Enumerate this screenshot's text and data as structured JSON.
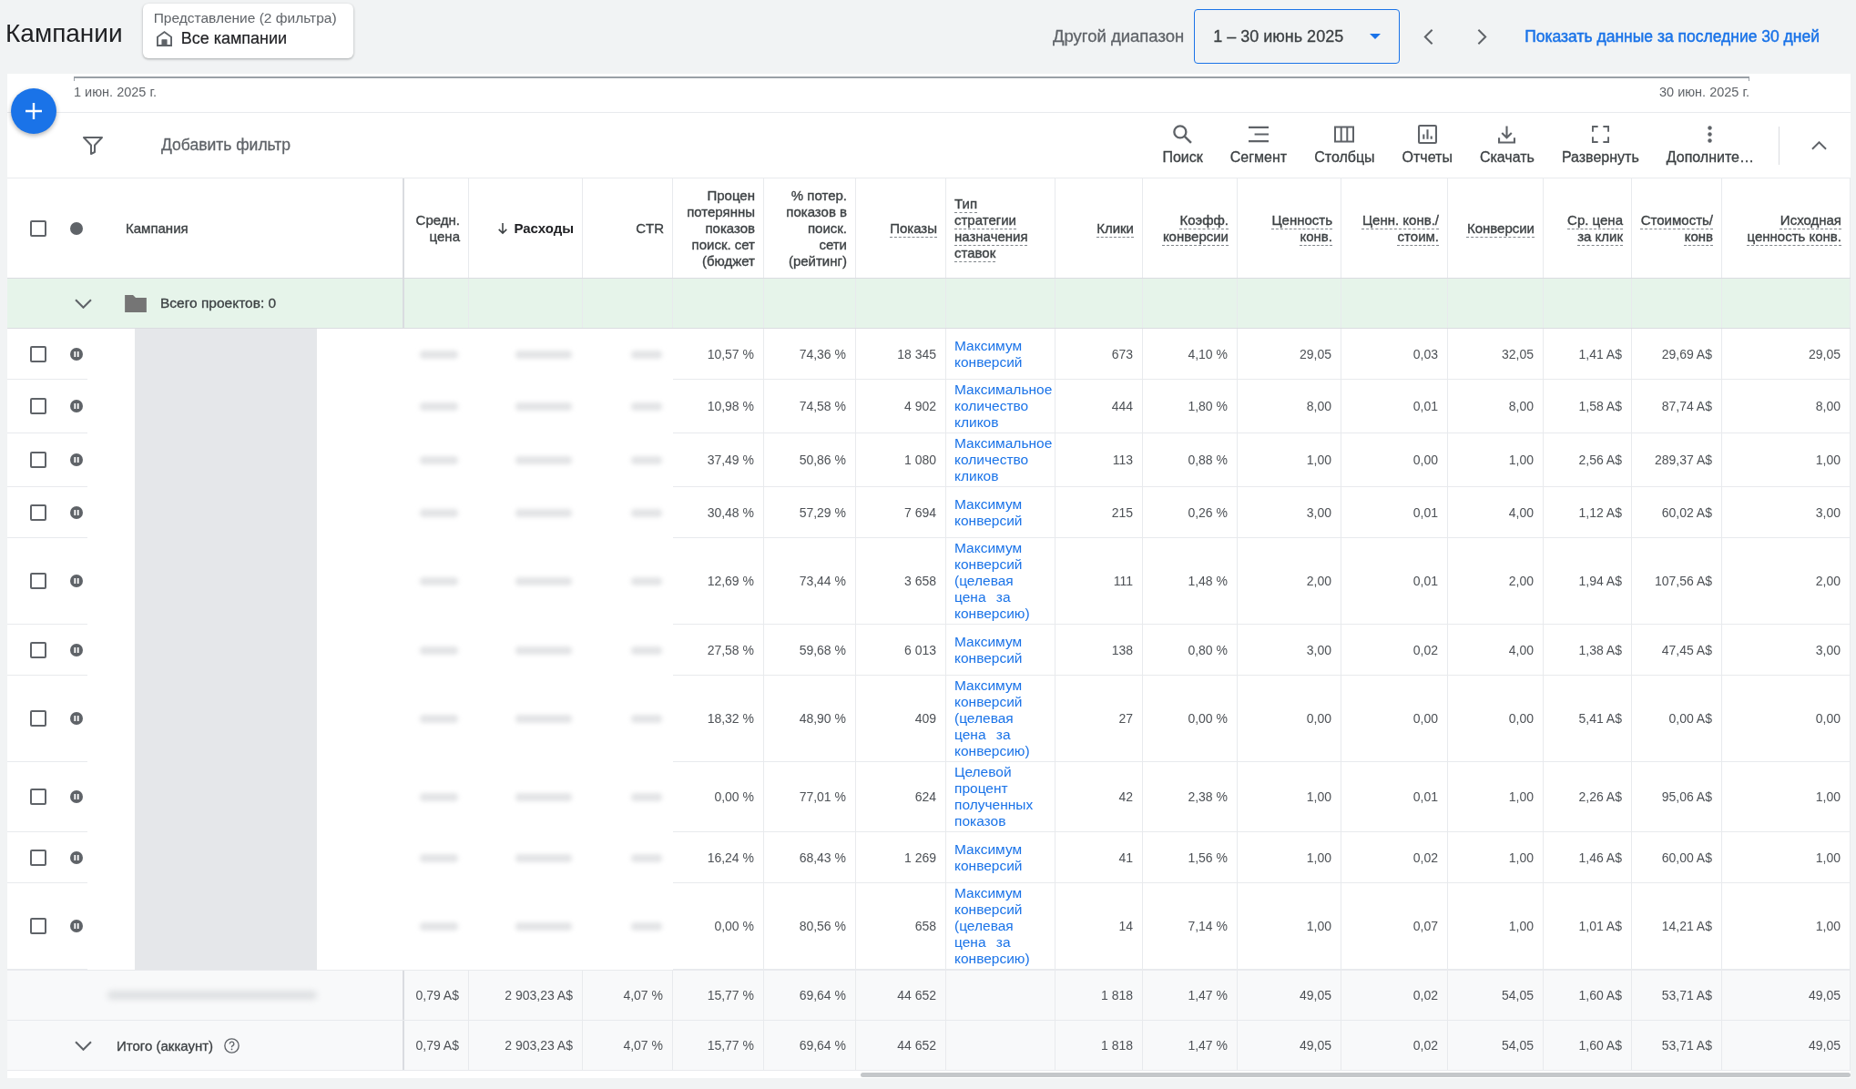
{
  "page_title": "Кампании",
  "view_selector": {
    "caption": "Представление (2 фильтра)",
    "value": "Все кампании"
  },
  "date_range": {
    "label": "Другой диапазон",
    "value": "1 – 30 июнь 2025",
    "quick_link": "Показать данные за последние 30 дней"
  },
  "timeline": {
    "start": "1 июн. 2025 г.",
    "end": "30 июн. 2025 г."
  },
  "filter_bar": {
    "add_filter": "Добавить фильтр"
  },
  "toolbar": [
    {
      "kind": "search",
      "label": "Поиск"
    },
    {
      "kind": "segment",
      "label": "Сегмент"
    },
    {
      "kind": "columns",
      "label": "Столбцы"
    },
    {
      "kind": "reports",
      "label": "Отчеты"
    },
    {
      "kind": "download",
      "label": "Скачать"
    },
    {
      "kind": "expand",
      "label": "Развернуть"
    },
    {
      "kind": "more",
      "label": "Дополните…"
    }
  ],
  "table": {
    "select_all_checked": false,
    "columns": [
      {
        "kind": "name",
        "label": "Кампания",
        "help": false,
        "sorted": false
      },
      {
        "kind": "number",
        "label": "Средн.\nцена",
        "help": false,
        "sorted": false
      },
      {
        "kind": "number",
        "label": "Расходы",
        "help": false,
        "sorted": true
      },
      {
        "kind": "number",
        "label": "CTR",
        "help": false,
        "sorted": false
      },
      {
        "kind": "number",
        "label": "Процен\nпотерянны\nпоказов\nпоиск. сет\n(бюджет",
        "help": false,
        "sorted": false
      },
      {
        "kind": "number",
        "label": "% потер.\nпоказов в\nпоиск.\nсети\n(рейтинг)",
        "help": false,
        "sorted": false
      },
      {
        "kind": "number",
        "label": "Показы",
        "help": true,
        "sorted": false
      },
      {
        "kind": "link",
        "label": "Тип\nстратегии\nназначения\nставок",
        "help": true,
        "sorted": false
      },
      {
        "kind": "number",
        "label": "Клики",
        "help": true,
        "sorted": false
      },
      {
        "kind": "number",
        "label": "Коэфф.\nконверсии",
        "help": true,
        "sorted": false
      },
      {
        "kind": "number",
        "label": "Ценность\nконв.",
        "help": true,
        "sorted": false
      },
      {
        "kind": "number",
        "label": "Ценн. конв./\nстоим.",
        "help": true,
        "sorted": false
      },
      {
        "kind": "number",
        "label": "Конверсии",
        "help": true,
        "sorted": false
      },
      {
        "kind": "number",
        "label": "Ср. цена\nза клик",
        "help": true,
        "sorted": false
      },
      {
        "kind": "number",
        "label": "Стоимость/\nконв",
        "help": true,
        "sorted": false
      },
      {
        "kind": "number",
        "label": "Исходная\nценность конв.",
        "help": true,
        "sorted": false
      }
    ],
    "group_row": {
      "label": "Всего проектов: 0"
    },
    "rows": [
      {
        "checked": false,
        "paused": true,
        "lost_is_budget": "10,57 %",
        "lost_is_rank": "74,36 %",
        "impressions": "18 345",
        "bid_strategy": "Максимум конверсий",
        "clicks": "673",
        "conv_rate": "4,10 %",
        "conv_value": "29,05",
        "value_per_cost": "0,03",
        "conversions": "32,05",
        "avg_cpc": "1,41 A$",
        "cost_per_conv": "29,69 A$",
        "orig_conv_value": "29,05"
      },
      {
        "checked": false,
        "paused": true,
        "lost_is_budget": "10,98 %",
        "lost_is_rank": "74,58 %",
        "impressions": "4 902",
        "bid_strategy": "Максимальное количество кликов",
        "clicks": "444",
        "conv_rate": "1,80 %",
        "conv_value": "8,00",
        "value_per_cost": "0,01",
        "conversions": "8,00",
        "avg_cpc": "1,58 A$",
        "cost_per_conv": "87,74 A$",
        "orig_conv_value": "8,00"
      },
      {
        "checked": false,
        "paused": true,
        "lost_is_budget": "37,49 %",
        "lost_is_rank": "50,86 %",
        "impressions": "1 080",
        "bid_strategy": "Максимальное количество кликов",
        "clicks": "113",
        "conv_rate": "0,88 %",
        "conv_value": "1,00",
        "value_per_cost": "0,00",
        "conversions": "1,00",
        "avg_cpc": "2,56 A$",
        "cost_per_conv": "289,37 A$",
        "orig_conv_value": "1,00"
      },
      {
        "checked": false,
        "paused": true,
        "lost_is_budget": "30,48 %",
        "lost_is_rank": "57,29 %",
        "impressions": "7 694",
        "bid_strategy": "Максимум конверсий",
        "clicks": "215",
        "conv_rate": "0,26 %",
        "conv_value": "3,00",
        "value_per_cost": "0,01",
        "conversions": "4,00",
        "avg_cpc": "1,12 A$",
        "cost_per_conv": "60,02 A$",
        "orig_conv_value": "3,00"
      },
      {
        "checked": false,
        "paused": true,
        "lost_is_budget": "12,69 %",
        "lost_is_rank": "73,44 %",
        "impressions": "3 658",
        "bid_strategy": "Максимум конверсий (целевая цена за конверсию)",
        "clicks": "111",
        "conv_rate": "1,48 %",
        "conv_value": "2,00",
        "value_per_cost": "0,01",
        "conversions": "2,00",
        "avg_cpc": "1,94 A$",
        "cost_per_conv": "107,56 A$",
        "orig_conv_value": "2,00"
      },
      {
        "checked": false,
        "paused": true,
        "lost_is_budget": "27,58 %",
        "lost_is_rank": "59,68 %",
        "impressions": "6 013",
        "bid_strategy": "Максимум конверсий",
        "clicks": "138",
        "conv_rate": "0,80 %",
        "conv_value": "3,00",
        "value_per_cost": "0,02",
        "conversions": "4,00",
        "avg_cpc": "1,38 A$",
        "cost_per_conv": "47,45 A$",
        "orig_conv_value": "3,00"
      },
      {
        "checked": false,
        "paused": true,
        "lost_is_budget": "18,32 %",
        "lost_is_rank": "48,90 %",
        "impressions": "409",
        "bid_strategy": "Максимум конверсий (целевая цена за конверсию)",
        "clicks": "27",
        "conv_rate": "0,00 %",
        "conv_value": "0,00",
        "value_per_cost": "0,00",
        "conversions": "0,00",
        "avg_cpc": "5,41 A$",
        "cost_per_conv": "0,00 A$",
        "orig_conv_value": "0,00"
      },
      {
        "checked": false,
        "paused": true,
        "lost_is_budget": "0,00 %",
        "lost_is_rank": "77,01 %",
        "impressions": "624",
        "bid_strategy": "Целевой процент полученных показов",
        "clicks": "42",
        "conv_rate": "2,38 %",
        "conv_value": "1,00",
        "value_per_cost": "0,01",
        "conversions": "1,00",
        "avg_cpc": "2,26 A$",
        "cost_per_conv": "95,06 A$",
        "orig_conv_value": "1,00"
      },
      {
        "checked": false,
        "paused": true,
        "lost_is_budget": "16,24 %",
        "lost_is_rank": "68,43 %",
        "impressions": "1 269",
        "bid_strategy": "Максимум конверсий",
        "clicks": "41",
        "conv_rate": "1,56 %",
        "conv_value": "1,00",
        "value_per_cost": "0,02",
        "conversions": "1,00",
        "avg_cpc": "1,46 A$",
        "cost_per_conv": "60,00 A$",
        "orig_conv_value": "1,00"
      },
      {
        "checked": false,
        "paused": true,
        "lost_is_budget": "0,00 %",
        "lost_is_rank": "80,56 %",
        "impressions": "658",
        "bid_strategy": "Максимум конверсий (целевая цена за конверсию)",
        "clicks": "14",
        "conv_rate": "7,14 %",
        "conv_value": "1,00",
        "value_per_cost": "0,07",
        "conversions": "1,00",
        "avg_cpc": "1,01 A$",
        "cost_per_conv": "14,21 A$",
        "orig_conv_value": "1,00"
      }
    ],
    "totals": [
      {
        "kind": "all_campaigns",
        "avg_price": "0,79 A$",
        "cost": "2 903,23 A$",
        "ctr": "4,07 %",
        "lost_is_budget": "15,77 %",
        "lost_is_rank": "69,64 %",
        "impressions": "44 652",
        "clicks": "1 818",
        "conv_rate": "1,47 %",
        "conv_value": "49,05",
        "value_per_cost": "0,02",
        "conversions": "54,05",
        "avg_cpc": "1,60 A$",
        "cost_per_conv": "53,71 A$",
        "orig_conv_value": "49,05"
      },
      {
        "kind": "account",
        "label": "Итого (аккаунт)",
        "avg_price": "0,79 A$",
        "cost": "2 903,23 A$",
        "ctr": "4,07 %",
        "lost_is_budget": "15,77 %",
        "lost_is_rank": "69,64 %",
        "impressions": "44 652",
        "clicks": "1 818",
        "conv_rate": "1,47 %",
        "conv_value": "49,05",
        "value_per_cost": "0,02",
        "conversions": "54,05",
        "avg_cpc": "1,60 A$",
        "cost_per_conv": "53,71 A$",
        "orig_conv_value": "49,05"
      }
    ]
  }
}
